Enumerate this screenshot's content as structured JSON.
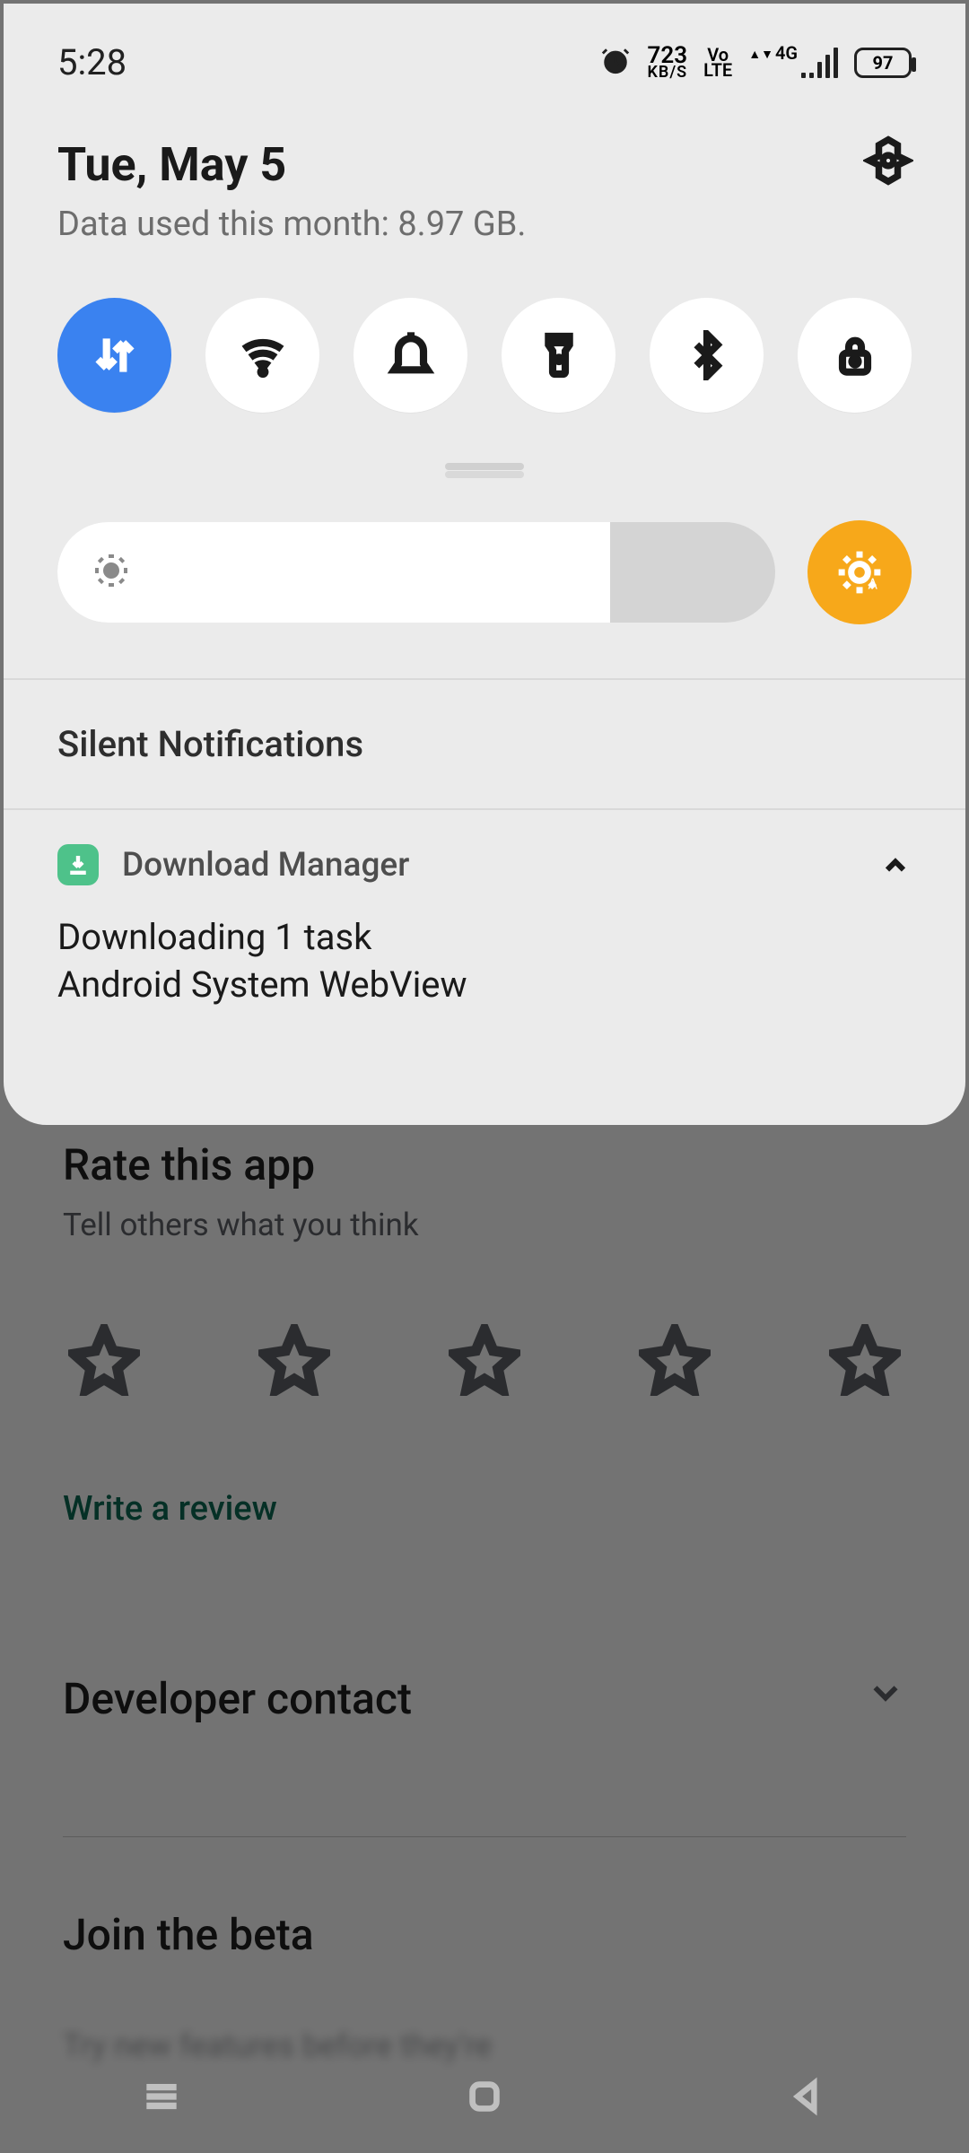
{
  "status": {
    "time": "5:28",
    "net_speed_top": "723",
    "net_speed_bot": "KB/S",
    "volte_top": "Vo",
    "volte_bot": "LTE",
    "signal_label": "4G",
    "battery": "97"
  },
  "header": {
    "date": "Tue, May 5",
    "data_usage": "Data used this month: 8.97 GB."
  },
  "qs": {
    "mobile_data_active": true
  },
  "brightness": {
    "fill_percent": 77
  },
  "silent_header": "Silent Notifications",
  "notification": {
    "app": "Download Manager",
    "title": "Downloading 1 task",
    "subtitle": "Android System WebView"
  },
  "playstore": {
    "rate_title": "Rate this app",
    "rate_sub": "Tell others what you think",
    "write_review": "Write a review",
    "dev_contact": "Developer contact",
    "join_beta": "Join the beta",
    "beta_sub": "Try new features before they're"
  }
}
